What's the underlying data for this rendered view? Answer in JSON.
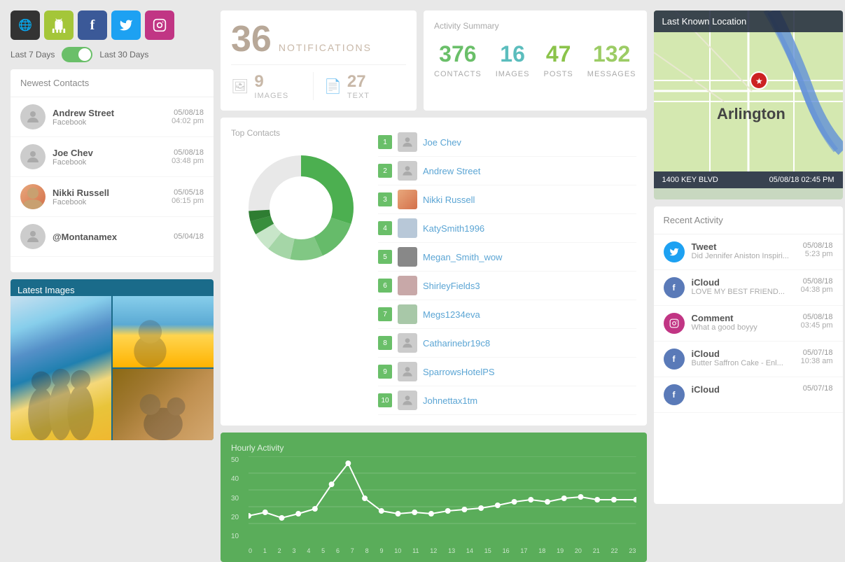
{
  "social": {
    "buttons": [
      {
        "id": "globe",
        "symbol": "🌐",
        "label": "Globe"
      },
      {
        "id": "android",
        "symbol": "🤖",
        "label": "Android"
      },
      {
        "id": "facebook",
        "symbol": "f",
        "label": "Facebook"
      },
      {
        "id": "twitter",
        "symbol": "t",
        "label": "Twitter"
      },
      {
        "id": "instagram",
        "symbol": "📷",
        "label": "Instagram"
      }
    ],
    "toggle_left": "Last 7 Days",
    "toggle_right": "Last 30 Days"
  },
  "notifications": {
    "count": "36",
    "label": "NOTIFICATIONS",
    "images_count": "9",
    "images_label": "IMAGES",
    "text_count": "27",
    "text_label": "TEXT"
  },
  "activity_summary": {
    "title": "Activity Summary",
    "stats": [
      {
        "value": "376",
        "label": "CONTACTS",
        "color": "green"
      },
      {
        "value": "16",
        "label": "IMAGES",
        "color": "teal"
      },
      {
        "value": "47",
        "label": "POSTS",
        "color": "olive"
      },
      {
        "value": "132",
        "label": "MESSAGES",
        "color": "light-green"
      }
    ]
  },
  "newest_contacts": {
    "title": "Newest Contacts",
    "items": [
      {
        "name": "Andrew Street",
        "source": "Facebook",
        "date": "05/08/18",
        "time": "04:02 pm",
        "has_photo": false
      },
      {
        "name": "Joe Chev",
        "source": "Facebook",
        "date": "05/08/18",
        "time": "03:48 pm",
        "has_photo": false
      },
      {
        "name": "Nikki Russell",
        "source": "Facebook",
        "date": "05/05/18",
        "time": "06:15 pm",
        "has_photo": true
      },
      {
        "name": "@Montanamex",
        "source": "",
        "date": "05/04/18",
        "time": "",
        "has_photo": false
      }
    ]
  },
  "latest_images": {
    "title": "Latest Images"
  },
  "top_contacts": {
    "title": "Top Contacts",
    "items": [
      {
        "rank": 1,
        "name": "Joe Chev"
      },
      {
        "rank": 2,
        "name": "Andrew Street"
      },
      {
        "rank": 3,
        "name": "Nikki Russell"
      },
      {
        "rank": 4,
        "name": "KatySmith1996"
      },
      {
        "rank": 5,
        "name": "Megan_Smith_wow"
      },
      {
        "rank": 6,
        "name": "ShirleyFields3"
      },
      {
        "rank": 7,
        "name": "Megs1234eva"
      },
      {
        "rank": 8,
        "name": "Catharinebr19c8"
      },
      {
        "rank": 9,
        "name": "SparrowsHotelPS"
      },
      {
        "rank": 10,
        "name": "Johnettax1tm"
      }
    ]
  },
  "hourly_activity": {
    "title": "Hourly Activity",
    "y_labels": [
      "50",
      "40",
      "30",
      "20",
      "10"
    ],
    "x_labels": [
      "0",
      "1",
      "2",
      "3",
      "4",
      "5",
      "6",
      "7",
      "8",
      "9",
      "10",
      "11",
      "12",
      "13",
      "14",
      "15",
      "16",
      "17",
      "18",
      "19",
      "20",
      "21",
      "22",
      "23"
    ]
  },
  "map": {
    "title": "Last Known Location",
    "label": "Arlington",
    "address": "1400 KEY BLVD",
    "datetime": "05/08/18 02:45 PM"
  },
  "recent_activity": {
    "title": "Recent Activity",
    "items": [
      {
        "type": "Tweet",
        "platform": "twitter",
        "text": "Did Jennifer Aniston Inspiri...",
        "date": "05/08/18",
        "time": "5:23 pm"
      },
      {
        "type": "iCloud",
        "platform": "icloud",
        "text": "LOVE MY BEST FRIEND...",
        "date": "05/08/18",
        "time": "04:38 pm"
      },
      {
        "type": "Comment",
        "platform": "instagram",
        "text": "What a good boyyy",
        "date": "05/08/18",
        "time": "03:45 pm"
      },
      {
        "type": "iCloud",
        "platform": "icloud",
        "text": "Butter Saffron Cake - Enl...",
        "date": "05/07/18",
        "time": "10:38 am"
      },
      {
        "type": "iCloud",
        "platform": "icloud",
        "text": "",
        "date": "05/07/18",
        "time": ""
      }
    ]
  }
}
